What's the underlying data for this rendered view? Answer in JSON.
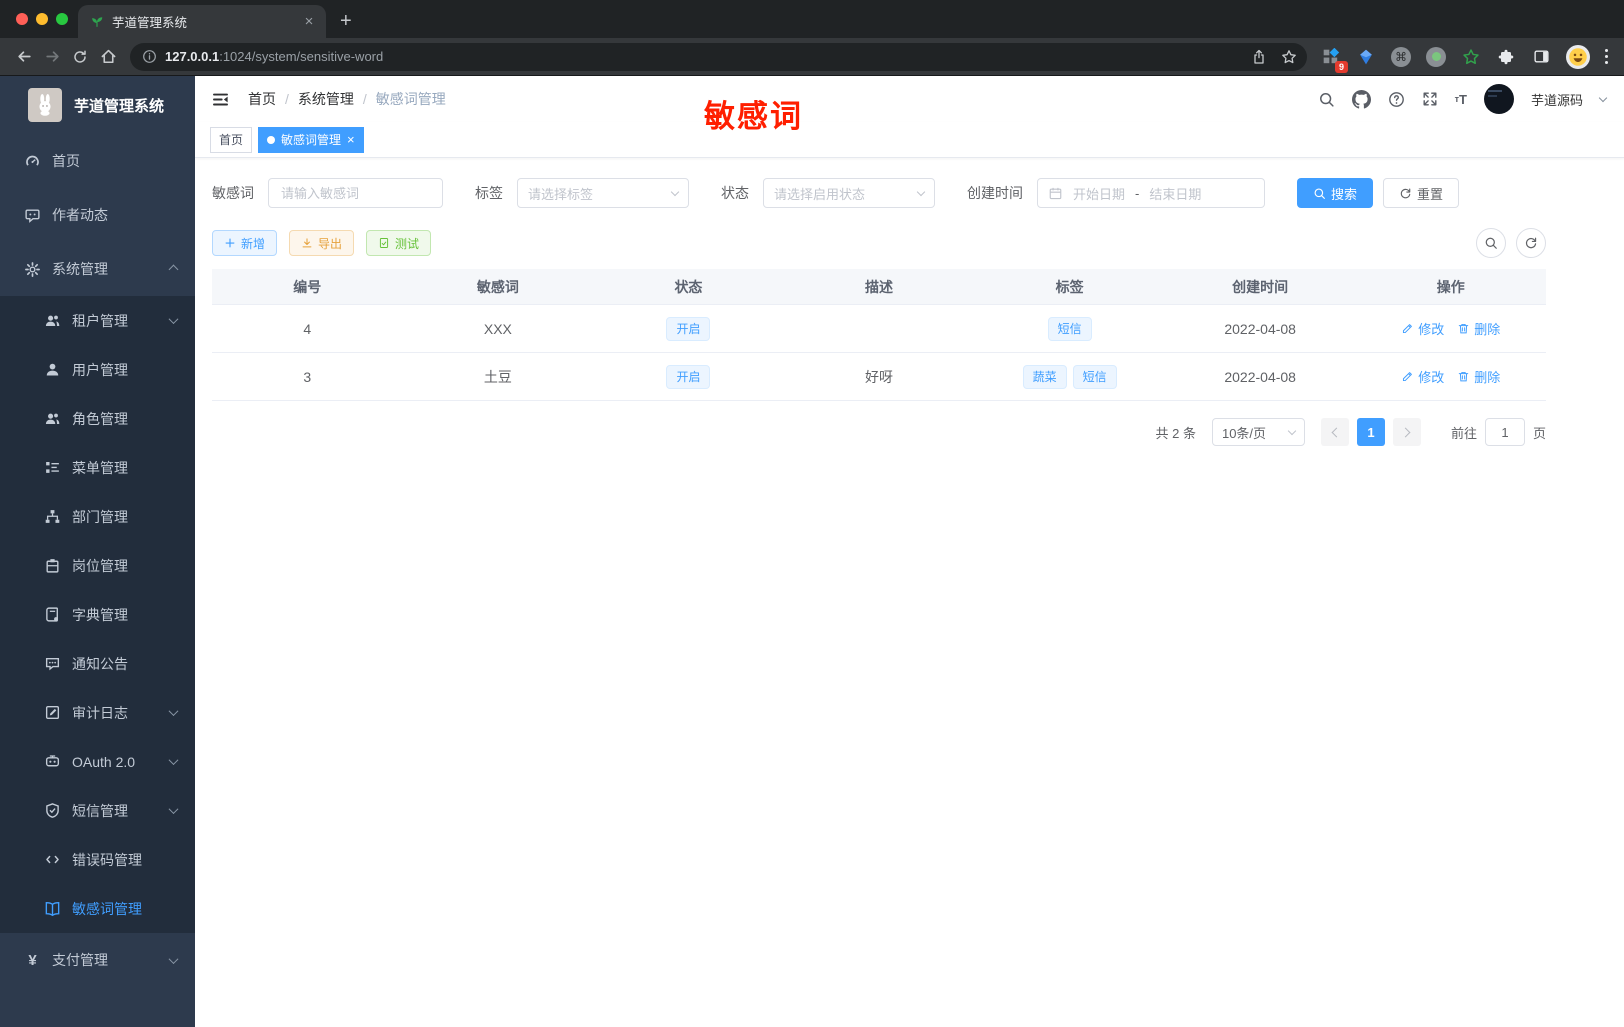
{
  "colors": {
    "accent": "#409eff",
    "success": "#67c23a",
    "warning": "#e6a23c",
    "annotation_red": "#ff1f00",
    "sidebar_bg": "#2d3a4d",
    "submenu_bg": "#222d3c"
  },
  "browser": {
    "tab_title": "芋道管理系统",
    "url_host": "127.0.0.1",
    "url_rest": ":1024/system/sensitive-word",
    "extension_badge": "9"
  },
  "sidebar": {
    "app_title": "芋道管理系统",
    "items": [
      {
        "label": "首页",
        "icon": "gauge-icon"
      },
      {
        "label": "作者动态",
        "icon": "chat-icon"
      },
      {
        "label": "系统管理",
        "icon": "gear-icon",
        "expanded": true
      },
      {
        "label": "租户管理",
        "icon": "users-icon"
      },
      {
        "label": "用户管理",
        "icon": "user-icon"
      },
      {
        "label": "角色管理",
        "icon": "users-icon"
      },
      {
        "label": "菜单管理",
        "icon": "tree-icon"
      },
      {
        "label": "部门管理",
        "icon": "org-icon"
      },
      {
        "label": "岗位管理",
        "icon": "badge-icon"
      },
      {
        "label": "字典管理",
        "icon": "dict-icon"
      },
      {
        "label": "通知公告",
        "icon": "notice-icon"
      },
      {
        "label": "审计日志",
        "icon": "audit-icon"
      },
      {
        "label": "OAuth 2.0",
        "icon": "robot-icon"
      },
      {
        "label": "短信管理",
        "icon": "shield-icon"
      },
      {
        "label": "错误码管理",
        "icon": "code-icon"
      },
      {
        "label": "敏感词管理",
        "icon": "open-book-icon",
        "active": true
      },
      {
        "label": "支付管理",
        "icon": "yen-icon"
      }
    ]
  },
  "header": {
    "breadcrumb": [
      "首页",
      "系统管理",
      "敏感词管理"
    ],
    "user_name": "芋道源码",
    "annotation": "敏感词"
  },
  "tags": [
    {
      "label": "首页",
      "active": false
    },
    {
      "label": "敏感词管理",
      "active": true
    }
  ],
  "filters": {
    "keyword_label": "敏感词",
    "keyword_placeholder": "请输入敏感词",
    "tag_label": "标签",
    "tag_placeholder": "请选择标签",
    "status_label": "状态",
    "status_placeholder": "请选择启用状态",
    "date_label": "创建时间",
    "date_start": "开始日期",
    "date_separator": "-",
    "date_end": "结束日期",
    "search_label": "搜索",
    "reset_label": "重置"
  },
  "actions": {
    "add": "新增",
    "export": "导出",
    "test": "测试"
  },
  "table": {
    "columns": [
      "编号",
      "敏感词",
      "状态",
      "描述",
      "标签",
      "创建时间",
      "操作"
    ],
    "edit_label": "修改",
    "delete_label": "删除",
    "rows": [
      {
        "id": "4",
        "word": "XXX",
        "status": "开启",
        "description": "",
        "tags": [
          "短信"
        ],
        "created": "2022-04-08"
      },
      {
        "id": "3",
        "word": "土豆",
        "status": "开启",
        "description": "好呀",
        "tags": [
          "蔬菜",
          "短信"
        ],
        "created": "2022-04-08"
      }
    ]
  },
  "pagination": {
    "total_text": "共 2 条",
    "page_size": "10条/页",
    "current_page": "1",
    "goto_label": "前往",
    "goto_value": "1",
    "page_unit": "页"
  },
  "icons": {
    "favicon": "seedling",
    "logo": "rabbit",
    "toolbar": [
      "back",
      "forward",
      "reload",
      "home",
      "site-info",
      "share",
      "bookmark-star"
    ],
    "nav_right": [
      "search",
      "github",
      "help",
      "fullscreen",
      "font-size"
    ]
  }
}
